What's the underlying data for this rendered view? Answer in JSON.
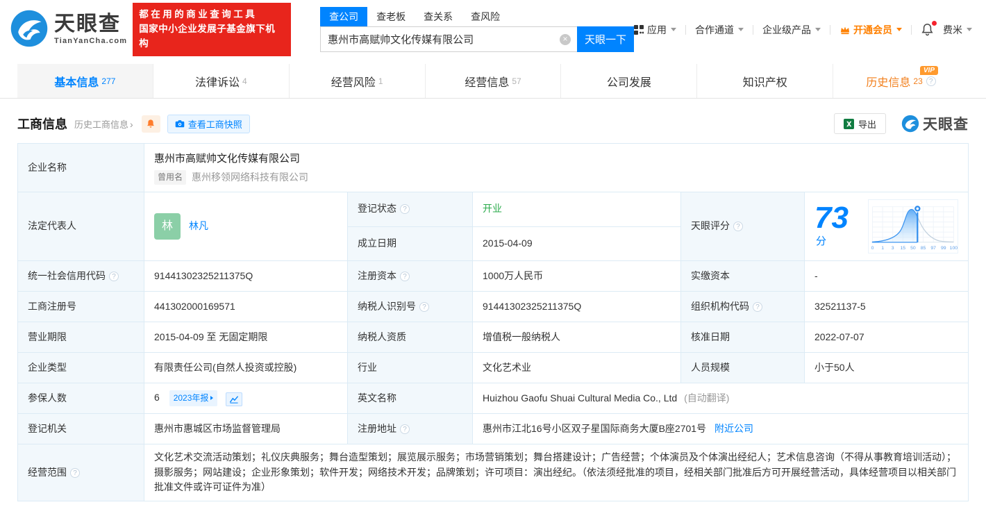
{
  "colors": {
    "accent": "#0084ff",
    "green": "#2bab4c",
    "orange": "#ff8000",
    "red": "#e8251c"
  },
  "brand": {
    "name": "天眼查",
    "site": "TianYanCha.com",
    "slogan1": "都在用的商业查询工具",
    "slogan2": "国家中小企业发展子基金旗下机构"
  },
  "search": {
    "tabs": [
      "查公司",
      "查老板",
      "查关系",
      "查风险"
    ],
    "value": "惠州市高赋帅文化传媒有限公司",
    "button": "天眼一下"
  },
  "topnav": {
    "apps": "应用",
    "cooperation": "合作通道",
    "enterprise": "企业级产品",
    "vip": "开通会员",
    "username": "费米"
  },
  "tabs": [
    {
      "label": "基本信息",
      "count": "277"
    },
    {
      "label": "法律诉讼",
      "count": "4"
    },
    {
      "label": "经营风险",
      "count": "1"
    },
    {
      "label": "经营信息",
      "count": "57"
    },
    {
      "label": "公司发展",
      "count": ""
    },
    {
      "label": "知识产权",
      "count": ""
    },
    {
      "label": "历史信息",
      "count": "23",
      "badge": "VIP"
    }
  ],
  "section": {
    "title": "工商信息",
    "history_link": "历史工商信息",
    "snapshot": "查看工商快照",
    "export": "导出",
    "watermark": "天眼查"
  },
  "score": {
    "label": "天眼评分",
    "value": "73",
    "unit": "分",
    "axis": [
      "0",
      "1",
      "3",
      "15",
      "50",
      "85",
      "97",
      "99",
      "100"
    ]
  },
  "biz": {
    "company_name_label": "企业名称",
    "company_name": "惠州市高赋帅文化传媒有限公司",
    "former_badge": "曾用名",
    "former_name": "惠州移领网络科技有限公司",
    "legal_rep_label": "法定代表人",
    "legal_rep_avatar": "林",
    "legal_rep_name": "林凡",
    "reg_status_label": "登记状态",
    "reg_status": "开业",
    "establish_date_label": "成立日期",
    "establish_date": "2015-04-09",
    "uscc_label": "统一社会信用代码",
    "uscc": "91441302325211375Q",
    "reg_capital_label": "注册资本",
    "reg_capital": "1000万人民币",
    "paid_capital_label": "实缴资本",
    "paid_capital": "-",
    "reg_number_label": "工商注册号",
    "reg_number": "441302000169571",
    "taxpayer_id_label": "纳税人识别号",
    "taxpayer_id": "91441302325211375Q",
    "org_code_label": "组织机构代码",
    "org_code": "32521137-5",
    "business_term_label": "营业期限",
    "business_term": "2015-04-09 至 无固定期限",
    "taxpayer_quality_label": "纳税人资质",
    "taxpayer_quality": "增值税一般纳税人",
    "approval_date_label": "核准日期",
    "approval_date": "2022-07-07",
    "company_type_label": "企业类型",
    "company_type": "有限责任公司(自然人投资或控股)",
    "industry_label": "行业",
    "industry": "文化艺术业",
    "staff_size_label": "人员规模",
    "staff_size": "小于50人",
    "insured_label": "参保人数",
    "insured": "6",
    "insured_report": "2023年报",
    "english_name_label": "英文名称",
    "english_name": "Huizhou Gaofu Shuai Cultural Media Co., Ltd",
    "english_name_note": "(自动翻译)",
    "reg_authority_label": "登记机关",
    "reg_authority": "惠州市惠城区市场监督管理局",
    "reg_address_label": "注册地址",
    "reg_address": "惠州市江北16号小区双子星国际商务大厦B座2701号",
    "nearby_link": "附近公司",
    "scope_label": "经营范围",
    "scope": "文化艺术交流活动策划；礼仪庆典服务；舞台造型策划；展览展示服务；市场营销策划；舞台搭建设计；广告经营；个体演员及个体演出经纪人；艺术信息咨询（不得从事教育培训活动）；摄影服务；网站建设；企业形象策划；软件开发；网络技术开发；品牌策划；许可项目：演出经纪。（依法须经批准的项目，经相关部门批准后方可开展经营活动，具体经营项目以相关部门批准文件或许可证件为准）"
  }
}
